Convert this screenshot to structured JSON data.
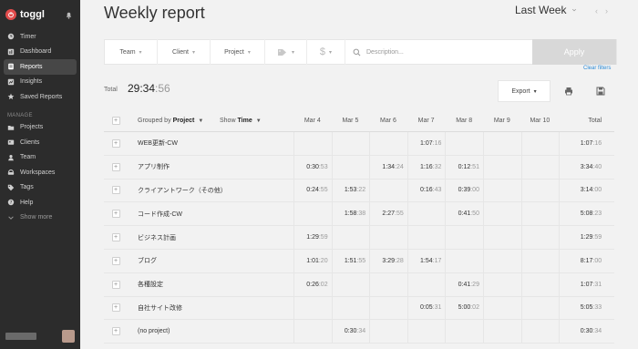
{
  "sidebar": {
    "brand": "toggl",
    "items": [
      {
        "label": "Timer",
        "icon": "clock-icon"
      },
      {
        "label": "Dashboard",
        "icon": "dashboard-icon"
      },
      {
        "label": "Reports",
        "icon": "reports-icon",
        "active": true
      },
      {
        "label": "Insights",
        "icon": "insights-icon"
      },
      {
        "label": "Saved Reports",
        "icon": "star-icon"
      }
    ],
    "manage_label": "MANAGE",
    "manage_items": [
      {
        "label": "Projects",
        "icon": "projects-icon"
      },
      {
        "label": "Clients",
        "icon": "clients-icon"
      },
      {
        "label": "Team",
        "icon": "team-icon"
      },
      {
        "label": "Workspaces",
        "icon": "workspaces-icon"
      },
      {
        "label": "Tags",
        "icon": "tag-icon"
      },
      {
        "label": "Help",
        "icon": "help-icon"
      }
    ],
    "show_more": "Show more"
  },
  "header": {
    "title": "Weekly report",
    "period": "Last Week"
  },
  "filters": {
    "team": "Team",
    "client": "Client",
    "project": "Project",
    "search_placeholder": "Description...",
    "apply": "Apply",
    "clear": "Clear filters"
  },
  "summary": {
    "total_label": "Total",
    "total_main": "29:34",
    "total_sec": ":56",
    "export_label": "Export"
  },
  "table": {
    "grouped_by": "Grouped by",
    "grouped_value": "Project",
    "show": "Show",
    "show_value": "Time",
    "days": [
      "Mar 4",
      "Mar 5",
      "Mar 6",
      "Mar 7",
      "Mar 8",
      "Mar 9",
      "Mar 10"
    ],
    "total_header": "Total",
    "rows": [
      {
        "name": "WEB更新-CW",
        "cells": [
          [
            "",
            ""
          ],
          [
            "",
            ""
          ],
          [
            "",
            ""
          ],
          [
            "1:07",
            ":16"
          ],
          [
            "",
            ""
          ],
          [
            "",
            ""
          ],
          [
            "",
            ""
          ]
        ],
        "total": [
          "1:07",
          ":16"
        ]
      },
      {
        "name": "アプリ制作",
        "cells": [
          [
            "0:30",
            ":53"
          ],
          [
            "",
            ""
          ],
          [
            "1:34",
            ":24"
          ],
          [
            "1:16",
            ":32"
          ],
          [
            "0:12",
            ":51"
          ],
          [
            "",
            ""
          ],
          [
            "",
            ""
          ]
        ],
        "total": [
          "3:34",
          ":40"
        ]
      },
      {
        "name": "クライアントワーク（その他）",
        "cells": [
          [
            "0:24",
            ":55"
          ],
          [
            "1:53",
            ":22"
          ],
          [
            "",
            ""
          ],
          [
            "0:16",
            ":43"
          ],
          [
            "0:39",
            ":00"
          ],
          [
            "",
            ""
          ],
          [
            "",
            ""
          ]
        ],
        "total": [
          "3:14",
          ":00"
        ]
      },
      {
        "name": "コード作成-CW",
        "cells": [
          [
            "",
            ""
          ],
          [
            "1:58",
            ":38"
          ],
          [
            "2:27",
            ":55"
          ],
          [
            "",
            ""
          ],
          [
            "0:41",
            ":50"
          ],
          [
            "",
            ""
          ],
          [
            "",
            ""
          ]
        ],
        "total": [
          "5:08",
          ":23"
        ]
      },
      {
        "name": "ビジネス計画",
        "cells": [
          [
            "1:29",
            ":59"
          ],
          [
            "",
            ""
          ],
          [
            "",
            ""
          ],
          [
            "",
            ""
          ],
          [
            "",
            ""
          ],
          [
            "",
            ""
          ],
          [
            "",
            ""
          ]
        ],
        "total": [
          "1:29",
          ":59"
        ]
      },
      {
        "name": "ブログ",
        "cells": [
          [
            "1:01",
            ":20"
          ],
          [
            "1:51",
            ":55"
          ],
          [
            "3:29",
            ":28"
          ],
          [
            "1:54",
            ":17"
          ],
          [
            "",
            ""
          ],
          [
            "",
            ""
          ],
          [
            "",
            ""
          ]
        ],
        "total": [
          "8:17",
          ":00"
        ]
      },
      {
        "name": "各種設定",
        "cells": [
          [
            "0:26",
            ":02"
          ],
          [
            "",
            ""
          ],
          [
            "",
            ""
          ],
          [
            "",
            ""
          ],
          [
            "0:41",
            ":29"
          ],
          [
            "",
            ""
          ],
          [
            "",
            ""
          ]
        ],
        "total": [
          "1:07",
          ":31"
        ]
      },
      {
        "name": "自社サイト改修",
        "cells": [
          [
            "",
            ""
          ],
          [
            "",
            ""
          ],
          [
            "",
            ""
          ],
          [
            "0:05",
            ":31"
          ],
          [
            "5:00",
            ":02"
          ],
          [
            "",
            ""
          ],
          [
            "",
            ""
          ]
        ],
        "total": [
          "5:05",
          ":33"
        ]
      },
      {
        "name": "(no project)",
        "cells": [
          [
            "",
            ""
          ],
          [
            "0:30",
            ":34"
          ],
          [
            "",
            ""
          ],
          [
            "",
            ""
          ],
          [
            "",
            ""
          ],
          [
            "",
            ""
          ],
          [
            "",
            ""
          ]
        ],
        "total": [
          "0:30",
          ":34"
        ]
      }
    ]
  }
}
